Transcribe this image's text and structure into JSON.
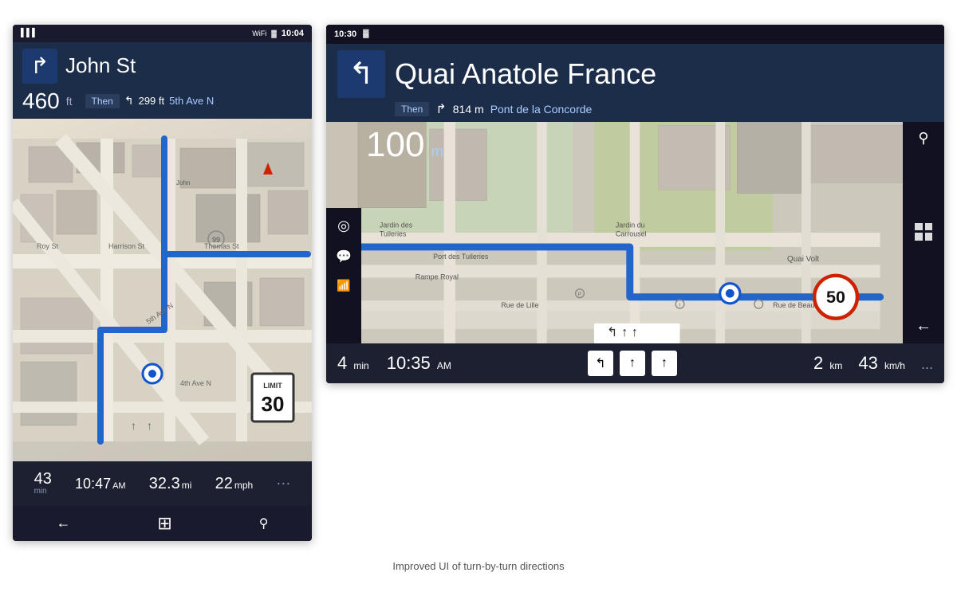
{
  "page": {
    "caption": "Improved UI of turn-by-turn directions"
  },
  "phone": {
    "status_bar": {
      "signal": "▌▌▌",
      "wifi": "WiFi",
      "battery": "🔋",
      "time": "10:04"
    },
    "nav": {
      "turn_arrow": "↱",
      "street_name": "John St",
      "distance": "460",
      "distance_unit": "ft",
      "then_label": "Then",
      "sub_turn": "↰",
      "sub_distance": "299 ft",
      "sub_street": "5th Ave N"
    },
    "speed_limit": {
      "top": "LIMIT",
      "number": "30"
    },
    "bottom_bar": {
      "time_remaining": "43",
      "time_remaining_unit": "min",
      "arrival": "10:47",
      "arrival_unit": "AM",
      "distance": "32.3",
      "distance_unit": "mi",
      "speed": "22",
      "speed_unit": "mph"
    },
    "taskbar": {
      "back": "←",
      "windows": "⊞",
      "search": "🔍"
    }
  },
  "tablet": {
    "status_bar": {
      "time": "10:30",
      "battery_icon": "🔋"
    },
    "nav": {
      "turn_arrow": "↰",
      "street_name": "Quai Anatole France",
      "distance": "100",
      "distance_unit": "m",
      "then_label": "Then",
      "sub_turn": "↱",
      "sub_distance": "814 m",
      "sub_street": "Pont de la Concorde"
    },
    "speed_limit": {
      "number": "50"
    },
    "bottom_bar": {
      "time_remaining": "4",
      "time_remaining_unit": "min",
      "arrival": "10:35",
      "arrival_unit": "AM",
      "distance": "2",
      "distance_unit": "km",
      "speed": "43",
      "speed_unit": "km/h",
      "more": "..."
    },
    "map_labels": {
      "jardin_tuileries": "Jardin des\nTuileries",
      "jardin_carrousel": "Jardin du\nCarrousel",
      "port_tuileries": "Port des Tuileries",
      "rampe_royal": "Rampe Royal",
      "rue_de_lille": "Rue de Lille",
      "quai_volt": "Quai Volt",
      "rue_beaune": "Rue de Beaune"
    },
    "taskbar": {
      "back": "←"
    },
    "left_sidebar": {
      "target": "◎",
      "message": "💬",
      "signal": "📶"
    },
    "right_sidebar": {
      "search": "🔍",
      "windows": "⊞",
      "back": "←"
    }
  }
}
